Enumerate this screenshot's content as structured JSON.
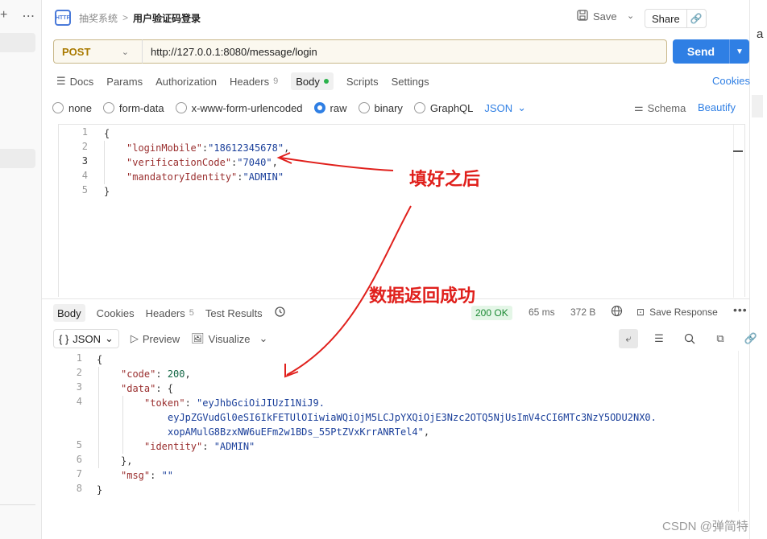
{
  "header": {
    "http_icon_text": "HTTP",
    "breadcrumb_parent": "抽奖系统",
    "breadcrumb_sep": ">",
    "title": "用户验证码登录",
    "save_label": "Save",
    "share_label": "Share"
  },
  "request": {
    "method": "POST",
    "url": "http://127.0.0.1:8080/message/login",
    "send_label": "Send",
    "tabs": [
      {
        "label": "Docs"
      },
      {
        "label": "Params"
      },
      {
        "label": "Authorization"
      },
      {
        "label": "Headers",
        "count": "9"
      },
      {
        "label": "Body"
      },
      {
        "label": "Scripts"
      },
      {
        "label": "Settings"
      }
    ],
    "cookies_label": "Cookies",
    "body_types": [
      "none",
      "form-data",
      "x-www-form-urlencoded",
      "raw",
      "binary",
      "GraphQL"
    ],
    "selected_body_type": "raw",
    "format": "JSON",
    "schema_label": "Schema",
    "beautify_label": "Beautify",
    "body_lines": {
      "n1": "1",
      "n2": "2",
      "n3": "3",
      "n4": "4",
      "n5": "5",
      "l1": "{",
      "l2_key": "\"loginMobile\"",
      "l2_val": "\"18612345678\"",
      "l3_key": "\"verificationCode\"",
      "l3_val": "\"7040\"",
      "l4_key": "\"mandatoryIdentity\"",
      "l4_val": "\"ADMIN\"",
      "l5": "}"
    }
  },
  "response": {
    "tabs": [
      {
        "label": "Body"
      },
      {
        "label": "Cookies"
      },
      {
        "label": "Headers",
        "count": "5"
      },
      {
        "label": "Test Results"
      }
    ],
    "status": "200 OK",
    "time": "65 ms",
    "size": "372 B",
    "save_response_label": "Save Response",
    "format": "JSON",
    "preview_label": "Preview",
    "visualize_label": "Visualize",
    "body_lines": {
      "n1": "1",
      "n2": "2",
      "n3": "3",
      "n4": "4",
      "n5": "5",
      "n6": "6",
      "n7": "7",
      "n8": "8",
      "l1": "{",
      "code_key": "\"code\"",
      "code_val": "200",
      "data_key": "\"data\"",
      "token_key": "\"token\"",
      "token_val_1": "\"eyJhbGciOiJIUzI1NiJ9.",
      "token_val_2": "eyJpZGVudGl0eSI6IkFETUlOIiwiaWQiOjM5LCJpYXQiOjE3Nzc2OTQ5NjUsImV4cCI6MTc3NzY5ODU2NX0.",
      "token_val_3": "xopAMulG8BzxNW6uEFm2w1BDs_55PtZVxKrrANRTel4\"",
      "identity_key": "\"identity\"",
      "identity_val": "\"ADMIN\"",
      "l6": "},",
      "msg_key": "\"msg\"",
      "msg_val": "\"\"",
      "l8": "}"
    }
  },
  "annotations": {
    "filled": "填好之后",
    "success": "数据返回成功",
    "color": "#e0201c"
  },
  "watermark": "CSDN @弹简特"
}
